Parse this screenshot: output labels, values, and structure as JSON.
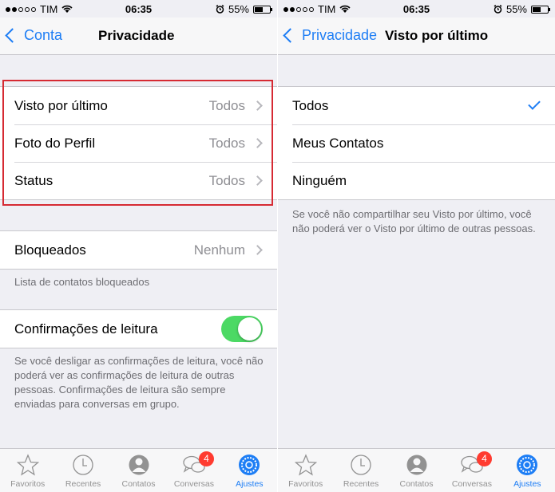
{
  "status": {
    "carrier": "TIM",
    "time": "06:35",
    "battery": "55%",
    "battery_level": 0.55
  },
  "left": {
    "nav": {
      "back_label": "Conta",
      "title": "Privacidade"
    },
    "privacy_rows": [
      {
        "label": "Visto por último",
        "value": "Todos"
      },
      {
        "label": "Foto do Perfil",
        "value": "Todos"
      },
      {
        "label": "Status",
        "value": "Todos"
      }
    ],
    "blocked": {
      "label": "Bloqueados",
      "value": "Nenhum",
      "footnote": "Lista de contatos bloqueados"
    },
    "read_receipts": {
      "label": "Confirmações de leitura",
      "enabled": true,
      "footnote": "Se você desligar as confirmações de leitura, você não poderá ver as confirmações de leitura de outras pessoas. Confirmações de leitura são sempre enviadas para conversas em grupo."
    }
  },
  "right": {
    "nav": {
      "back_label": "Privacidade",
      "title": "Visto por último"
    },
    "options": [
      {
        "label": "Todos",
        "selected": true
      },
      {
        "label": "Meus Contatos",
        "selected": false
      },
      {
        "label": "Ninguém",
        "selected": false
      }
    ],
    "footnote": "Se você não compartilhar seu Visto por último, você não poderá ver o Visto por último de outras pessoas."
  },
  "tabbar": {
    "tabs": [
      {
        "label": "Favoritos",
        "icon": "star-icon"
      },
      {
        "label": "Recentes",
        "icon": "clock-icon"
      },
      {
        "label": "Contatos",
        "icon": "person-icon"
      },
      {
        "label": "Conversas",
        "icon": "chat-bubbles-icon",
        "badge": "4"
      },
      {
        "label": "Ajustes",
        "icon": "settings-gear-icon",
        "active": true
      }
    ]
  },
  "colors": {
    "accent": "#1e7ef5",
    "toggle_on": "#4cd964",
    "badge": "#ff3b30",
    "highlight_box": "#d62a33"
  }
}
